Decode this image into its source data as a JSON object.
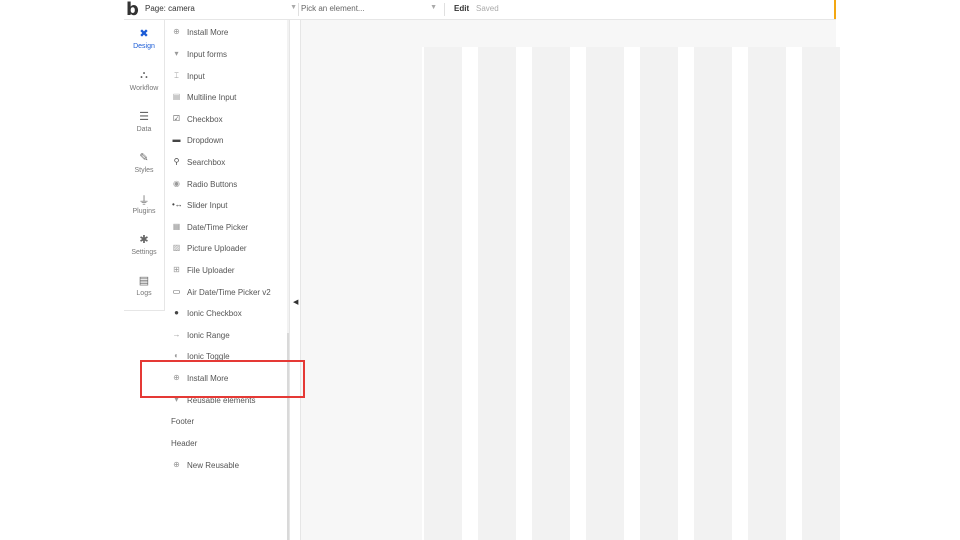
{
  "topbar": {
    "logo": "b",
    "page_label": "Page: camera",
    "element_placeholder": "Pick an element...",
    "edit_label": "Edit",
    "saved_label": "Saved",
    "accent_color": "#f3a712"
  },
  "leftnav": [
    {
      "label": "Design",
      "icon": "design-icon",
      "active": true
    },
    {
      "label": "Workflow",
      "icon": "workflow-icon"
    },
    {
      "label": "Data",
      "icon": "database-icon"
    },
    {
      "label": "Styles",
      "icon": "brush-icon"
    },
    {
      "label": "Plugins",
      "icon": "plug-icon"
    },
    {
      "label": "Settings",
      "icon": "gear-icon"
    },
    {
      "label": "Logs",
      "icon": "document-icon"
    }
  ],
  "palette": {
    "items": [
      {
        "label": "Install More",
        "icon": "plus-circle-icon"
      },
      {
        "label": "Input forms",
        "icon": "caret-down-icon"
      },
      {
        "label": "Input",
        "icon": "input-icon"
      },
      {
        "label": "Multiline Input",
        "icon": "multiline-icon"
      },
      {
        "label": "Checkbox",
        "icon": "checkbox-icon"
      },
      {
        "label": "Dropdown",
        "icon": "dropdown-icon"
      },
      {
        "label": "Searchbox",
        "icon": "search-icon"
      },
      {
        "label": "Radio Buttons",
        "icon": "radio-icon"
      },
      {
        "label": "Slider Input",
        "icon": "slider-icon"
      },
      {
        "label": "Date/Time Picker",
        "icon": "calendar-icon"
      },
      {
        "label": "Picture Uploader",
        "icon": "picture-icon"
      },
      {
        "label": "File Uploader",
        "icon": "file-upload-icon"
      },
      {
        "label": "Air Date/Time Picker v2",
        "icon": "calendar-icon"
      },
      {
        "label": "Ionic Checkbox",
        "icon": "ionic-check-icon"
      },
      {
        "label": "Ionic Range",
        "icon": "range-icon"
      },
      {
        "label": "Ionic Toggle",
        "icon": "toggle-icon"
      },
      {
        "label": "Install More",
        "icon": "plus-circle-icon"
      },
      {
        "label": "Reusable elements",
        "icon": "caret-down-icon"
      },
      {
        "label": "Footer",
        "icon": ""
      },
      {
        "label": "Header",
        "icon": ""
      },
      {
        "label": "New Reusable",
        "icon": "plus-circle-icon"
      }
    ]
  },
  "highlight_color": "#e53935"
}
